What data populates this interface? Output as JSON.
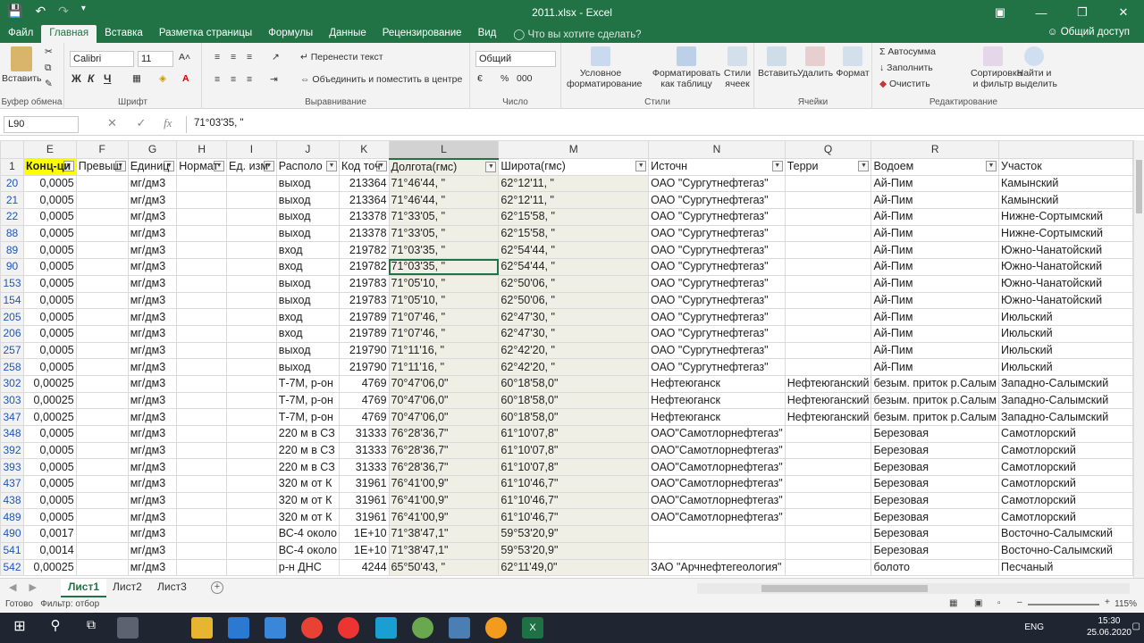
{
  "window": {
    "title": "2011.xlsx - Excel",
    "save_icon": "save-icon",
    "undo_icon": "undo-icon",
    "redo_icon": "redo-icon"
  },
  "menu": {
    "tabs": [
      "Файл",
      "Главная",
      "Вставка",
      "Разметка страницы",
      "Формулы",
      "Данные",
      "Рецензирование",
      "Вид"
    ],
    "tell_me": "Что вы хотите сделать?",
    "share": "Общий доступ"
  },
  "ribbon": {
    "clipboard": {
      "label": "Буфер обмена",
      "paste": "Вставить"
    },
    "font": {
      "label": "Шрифт",
      "name": "Calibri",
      "size": "11",
      "bold": "Ж",
      "italic": "К",
      "underline": "Ч"
    },
    "align": {
      "label": "Выравнивание",
      "wrap": "Перенести текст",
      "merge": "Объединить и поместить в центре"
    },
    "number": {
      "label": "Число",
      "format": "Общий",
      "percent": "%",
      "thousands": "000"
    },
    "styles": {
      "label": "Стили",
      "conditional": "Условное форматирование",
      "as_table": "Форматировать как таблицу",
      "cell_styles": "Стили ячеек"
    },
    "cells": {
      "label": "Ячейки",
      "insert": "Вставить",
      "delete": "Удалить",
      "format": "Формат"
    },
    "editing": {
      "label": "Редактирование",
      "autosum": "Автосумма",
      "fill": "Заполнить",
      "clear": "Очистить",
      "sort": "Сортировка и фильтр",
      "find": "Найти и выделить"
    }
  },
  "formula_bar": {
    "name_box": "L90",
    "fx": "fx",
    "value": "71°03'35, \""
  },
  "columns": [
    "E",
    "F",
    "G",
    "H",
    "I",
    "J",
    "K",
    "L",
    "M",
    "N",
    "Q",
    "R"
  ],
  "header_row": {
    "row_num": "1",
    "cells": [
      "Конц-ци",
      "Превыш",
      "Единиц",
      "Нормат",
      "Ед. изм",
      "Располо",
      "Код точ",
      "Долгота(гмс)",
      "Широта(гмс)",
      "Источн",
      "Терри",
      "Водоем",
      "Участок"
    ]
  },
  "rows": [
    {
      "n": "20",
      "E": "0,0005",
      "G": "мг/дм3",
      "J": "выход",
      "K": "213364",
      "L": "71°46'44, \"",
      "M": "62°12'11, \"",
      "N": "ОАО \"Сургутнефтегаз\"",
      "Q": "",
      "R": "Ай-Пим",
      "S": "Камынский"
    },
    {
      "n": "21",
      "E": "0,0005",
      "G": "мг/дм3",
      "J": "выход",
      "K": "213364",
      "L": "71°46'44, \"",
      "M": "62°12'11, \"",
      "N": "ОАО \"Сургутнефтегаз\"",
      "Q": "",
      "R": "Ай-Пим",
      "S": "Камынский"
    },
    {
      "n": "22",
      "E": "0,0005",
      "G": "мг/дм3",
      "J": "выход",
      "K": "213378",
      "L": "71°33'05, \"",
      "M": "62°15'58, \"",
      "N": "ОАО \"Сургутнефтегаз\"",
      "Q": "",
      "R": "Ай-Пим",
      "S": "Нижне-Сортымский"
    },
    {
      "n": "88",
      "E": "0,0005",
      "G": "мг/дм3",
      "J": "выход",
      "K": "213378",
      "L": "71°33'05, \"",
      "M": "62°15'58, \"",
      "N": "ОАО \"Сургутнефтегаз\"",
      "Q": "",
      "R": "Ай-Пим",
      "S": "Нижне-Сортымский"
    },
    {
      "n": "89",
      "E": "0,0005",
      "G": "мг/дм3",
      "J": "вход",
      "K": "219782",
      "L": "71°03'35, \"",
      "M": "62°54'44, \"",
      "N": "ОАО \"Сургутнефтегаз\"",
      "Q": "",
      "R": "Ай-Пим",
      "S": "Южно-Чанатойский"
    },
    {
      "n": "90",
      "E": "0,0005",
      "G": "мг/дм3",
      "J": "вход",
      "K": "219782",
      "L": "71°03'35, \"",
      "M": "62°54'44, \"",
      "N": "ОАО \"Сургутнефтегаз\"",
      "Q": "",
      "R": "Ай-Пим",
      "S": "Южно-Чанатойский"
    },
    {
      "n": "153",
      "E": "0,0005",
      "G": "мг/дм3",
      "J": "выход",
      "K": "219783",
      "L": "71°05'10, \"",
      "M": "62°50'06, \"",
      "N": "ОАО \"Сургутнефтегаз\"",
      "Q": "",
      "R": "Ай-Пим",
      "S": "Южно-Чанатойский"
    },
    {
      "n": "154",
      "E": "0,0005",
      "G": "мг/дм3",
      "J": "выход",
      "K": "219783",
      "L": "71°05'10, \"",
      "M": "62°50'06, \"",
      "N": "ОАО \"Сургутнефтегаз\"",
      "Q": "",
      "R": "Ай-Пим",
      "S": "Южно-Чанатойский"
    },
    {
      "n": "205",
      "E": "0,0005",
      "G": "мг/дм3",
      "J": "вход",
      "K": "219789",
      "L": "71°07'46, \"",
      "M": "62°47'30, \"",
      "N": "ОАО \"Сургутнефтегаз\"",
      "Q": "",
      "R": "Ай-Пим",
      "S": "Июльский"
    },
    {
      "n": "206",
      "E": "0,0005",
      "G": "мг/дм3",
      "J": "вход",
      "K": "219789",
      "L": "71°07'46, \"",
      "M": "62°47'30, \"",
      "N": "ОАО \"Сургутнефтегаз\"",
      "Q": "",
      "R": "Ай-Пим",
      "S": "Июльский"
    },
    {
      "n": "257",
      "E": "0,0005",
      "G": "мг/дм3",
      "J": "выход",
      "K": "219790",
      "L": "71°11'16, \"",
      "M": "62°42'20, \"",
      "N": "ОАО \"Сургутнефтегаз\"",
      "Q": "",
      "R": "Ай-Пим",
      "S": "Июльский"
    },
    {
      "n": "258",
      "E": "0,0005",
      "G": "мг/дм3",
      "J": "выход",
      "K": "219790",
      "L": "71°11'16, \"",
      "M": "62°42'20, \"",
      "N": "ОАО \"Сургутнефтегаз\"",
      "Q": "",
      "R": "Ай-Пим",
      "S": "Июльский"
    },
    {
      "n": "302",
      "E": "0,00025",
      "G": "мг/дм3",
      "J": "Т-7М, р-он",
      "K": "4769",
      "L": "70°47'06,0\"",
      "M": "60°18'58,0\"",
      "N": "Нефтеюганск",
      "Q": "Нефтеюганский",
      "R": "безым. приток р.Салым",
      "S": "Западно-Салымский"
    },
    {
      "n": "303",
      "E": "0,00025",
      "G": "мг/дм3",
      "J": "Т-7М, р-он",
      "K": "4769",
      "L": "70°47'06,0\"",
      "M": "60°18'58,0\"",
      "N": "Нефтеюганск",
      "Q": "Нефтеюганский",
      "R": "безым. приток р.Салым",
      "S": "Западно-Салымский"
    },
    {
      "n": "347",
      "E": "0,00025",
      "G": "мг/дм3",
      "J": "Т-7М, р-он",
      "K": "4769",
      "L": "70°47'06,0\"",
      "M": "60°18'58,0\"",
      "N": "Нефтеюганск",
      "Q": "Нефтеюганский",
      "R": "безым. приток р.Салым",
      "S": "Западно-Салымский"
    },
    {
      "n": "348",
      "E": "0,0005",
      "G": "мг/дм3",
      "J": "220 м в СЗ",
      "K": "31333",
      "L": "76°28'36,7\"",
      "M": "61°10'07,8\"",
      "N": "ОАО\"Самотлорнефтегаз\"",
      "Q": "",
      "R": "Березовая",
      "S": "Самотлорский"
    },
    {
      "n": "392",
      "E": "0,0005",
      "G": "мг/дм3",
      "J": "220 м в СЗ",
      "K": "31333",
      "L": "76°28'36,7\"",
      "M": "61°10'07,8\"",
      "N": "ОАО\"Самотлорнефтегаз\"",
      "Q": "",
      "R": "Березовая",
      "S": "Самотлорский"
    },
    {
      "n": "393",
      "E": "0,0005",
      "G": "мг/дм3",
      "J": "220 м в СЗ",
      "K": "31333",
      "L": "76°28'36,7\"",
      "M": "61°10'07,8\"",
      "N": "ОАО\"Самотлорнефтегаз\"",
      "Q": "",
      "R": "Березовая",
      "S": "Самотлорский"
    },
    {
      "n": "437",
      "E": "0,0005",
      "G": "мг/дм3",
      "J": "320 м от К",
      "K": "31961",
      "L": "76°41'00,9\"",
      "M": "61°10'46,7\"",
      "N": "ОАО\"Самотлорнефтегаз\"",
      "Q": "",
      "R": "Березовая",
      "S": "Самотлорский"
    },
    {
      "n": "438",
      "E": "0,0005",
      "G": "мг/дм3",
      "J": "320 м от К",
      "K": "31961",
      "L": "76°41'00,9\"",
      "M": "61°10'46,7\"",
      "N": "ОАО\"Самотлорнефтегаз\"",
      "Q": "",
      "R": "Березовая",
      "S": "Самотлорский"
    },
    {
      "n": "489",
      "E": "0,0005",
      "G": "мг/дм3",
      "J": "320 м от К",
      "K": "31961",
      "L": "76°41'00,9\"",
      "M": "61°10'46,7\"",
      "N": "ОАО\"Самотлорнефтегаз\"",
      "Q": "",
      "R": "Березовая",
      "S": "Самотлорский"
    },
    {
      "n": "490",
      "E": "0,0017",
      "G": "мг/дм3",
      "J": "ВС-4 около",
      "K": "1E+10",
      "L": "71°38'47,1\"",
      "M": "59°53'20,9\"",
      "N": "",
      "Q": "",
      "R": "Березовая",
      "S": "Восточно-Салымский"
    },
    {
      "n": "541",
      "E": "0,0014",
      "G": "мг/дм3",
      "J": "ВС-4 около",
      "K": "1E+10",
      "L": "71°38'47,1\"",
      "M": "59°53'20,9\"",
      "N": "",
      "Q": "",
      "R": "Березовая",
      "S": "Восточно-Салымский"
    },
    {
      "n": "542",
      "E": "0,00025",
      "G": "мг/дм3",
      "J": "р-н ДНС",
      "K": "4244",
      "L": "65°50'43, \"",
      "M": "62°11'49,0\"",
      "N": "ЗАО \"Арчнефтегеология\"",
      "Q": "",
      "R": "болото",
      "S": "Песчаный"
    }
  ],
  "sheets": [
    "Лист1",
    "Лист2",
    "Лист3"
  ],
  "status": {
    "ready": "Готово",
    "filter": "Фильтр: отбор",
    "zoom": "115%"
  },
  "taskbar": {
    "lang": "ENG",
    "time": "15:30",
    "date": "25.06.2020"
  }
}
